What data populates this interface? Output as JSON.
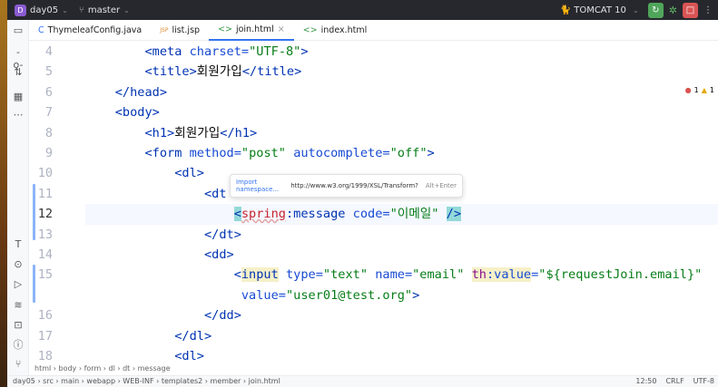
{
  "topbar": {
    "project_badge": "D",
    "project": "day05",
    "branch_icon": "git-branch-icon",
    "branch": "master",
    "run_config": "TOMCAT 10",
    "colors": {
      "rerun": "#4fa55a",
      "stop": "#d95454",
      "bar": "#27282e"
    }
  },
  "tabs": [
    {
      "label": "ThymeleafConfig.java",
      "icon": "C"
    },
    {
      "label": "list.jsp",
      "icon": "JSP"
    },
    {
      "label": "join.html",
      "icon": "<>",
      "active": true,
      "close": "×"
    },
    {
      "label": "index.html",
      "icon": "<>"
    }
  ],
  "inspections": {
    "errors": "1",
    "warnings": "1"
  },
  "gutter": {
    "lines": [
      "4",
      "5",
      "6",
      "7",
      "8",
      "9",
      "10",
      "11",
      "12",
      "13",
      "14",
      "15",
      "",
      "16",
      "17",
      "18"
    ]
  },
  "code": [
    [
      [
        "        ",
        ""
      ],
      [
        "<meta ",
        "t"
      ],
      [
        "charset=",
        "a"
      ],
      [
        "\"UTF-8\"",
        "v"
      ],
      [
        ">",
        "t"
      ]
    ],
    [
      [
        "        ",
        ""
      ],
      [
        "<title>",
        "t"
      ],
      [
        "회원가입",
        "x"
      ],
      [
        "</title>",
        "t"
      ]
    ],
    [
      [
        "    ",
        ""
      ],
      [
        "</head>",
        "t"
      ]
    ],
    [
      [
        "    ",
        ""
      ],
      [
        "<body>",
        "t"
      ]
    ],
    [
      [
        "        ",
        ""
      ],
      [
        "<h1>",
        "t"
      ],
      [
        "회원가입",
        "x"
      ],
      [
        "</h1>",
        "t"
      ]
    ],
    [
      [
        "        ",
        ""
      ],
      [
        "<form ",
        "t"
      ],
      [
        "method=",
        "a"
      ],
      [
        "\"post\" ",
        "v"
      ],
      [
        "autocomplete=",
        "a"
      ],
      [
        "\"off\"",
        "v"
      ],
      [
        ">",
        "t"
      ]
    ],
    [
      [
        "            ",
        ""
      ],
      [
        "<dl>",
        "t"
      ]
    ],
    [
      [
        "                ",
        ""
      ],
      [
        "<dt",
        "t"
      ]
    ],
    [
      [
        "                    ",
        ""
      ],
      [
        "<",
        "t br"
      ],
      [
        "spring",
        "ns"
      ],
      [
        ":message ",
        "t"
      ],
      [
        "code=",
        "a"
      ],
      [
        "\"이메일\" ",
        "v"
      ],
      [
        "/>",
        "t br"
      ]
    ],
    [
      [
        "                ",
        ""
      ],
      [
        "</dt>",
        "t"
      ]
    ],
    [
      [
        "                ",
        ""
      ],
      [
        "<dd>",
        "t"
      ]
    ],
    [
      [
        "                    ",
        ""
      ],
      [
        "<",
        "t"
      ],
      [
        "input",
        "t hl"
      ],
      [
        " type=",
        "a"
      ],
      [
        "\"text\" ",
        "v"
      ],
      [
        "name=",
        "a"
      ],
      [
        "\"email\" ",
        "v"
      ],
      [
        "th",
        "th hl"
      ],
      [
        ":value",
        "a hl"
      ],
      [
        "=",
        "a"
      ],
      [
        "\"${requestJoin.email}\"",
        "v"
      ]
    ],
    [
      [
        "                     ",
        ""
      ],
      [
        "value=",
        "a"
      ],
      [
        "\"user01@test.org\"",
        "v"
      ],
      [
        ">",
        "t"
      ]
    ],
    [
      [
        "                ",
        ""
      ],
      [
        "</dd>",
        "t"
      ]
    ],
    [
      [
        "            ",
        ""
      ],
      [
        "</dl>",
        "t"
      ]
    ],
    [
      [
        "            ",
        ""
      ],
      [
        "<dl>",
        "t"
      ]
    ]
  ],
  "popup": {
    "action": "Import namespace...",
    "url": "http://www.w3.org/1999/XSL/Transform?",
    "shortcut": "Alt+Enter"
  },
  "breadcrumbs": "html › body › form › dl › dt › message",
  "status": {
    "path": "day05 › src › main › webapp › WEB-INF › templates2 › member › join.html",
    "position": "12:50",
    "line_ending": "CRLF",
    "encoding": "UTF-8"
  }
}
